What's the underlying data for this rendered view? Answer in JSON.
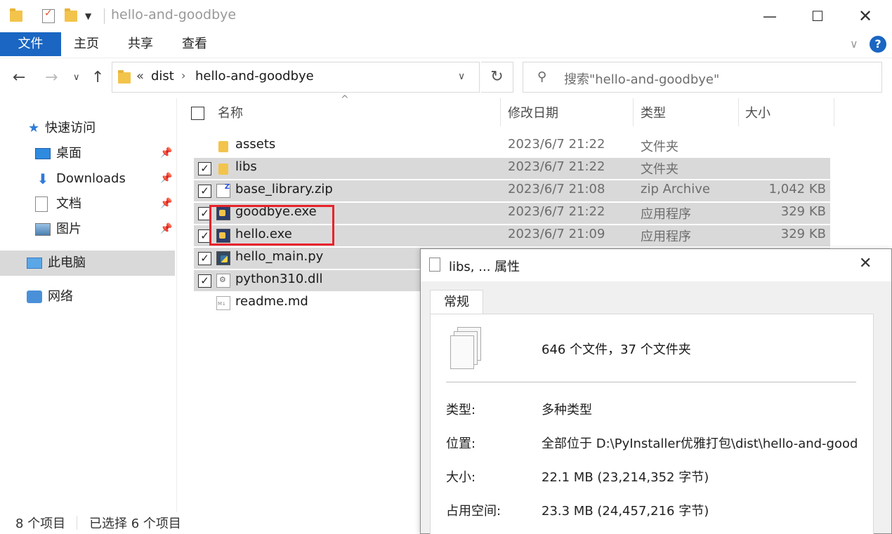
{
  "window": {
    "title": "hello-and-goodbye"
  },
  "ribbon": {
    "tabs": [
      "文件",
      "主页",
      "共享",
      "查看"
    ]
  },
  "address": {
    "prefix": "«",
    "crumbs": [
      "dist",
      "hello-and-goodbye"
    ]
  },
  "search": {
    "placeholder": "搜索\"hello-and-goodbye\""
  },
  "sidebar": {
    "quick_access": "快速访问",
    "items": [
      {
        "label": "桌面",
        "icon": "desktop-icon"
      },
      {
        "label": "Downloads",
        "icon": "download-icon"
      },
      {
        "label": "文档",
        "icon": "document-icon"
      },
      {
        "label": "图片",
        "icon": "pictures-icon"
      }
    ],
    "this_pc": "此电脑",
    "network": "网络"
  },
  "columns": {
    "name": "名称",
    "date": "修改日期",
    "type": "类型",
    "size": "大小"
  },
  "files": [
    {
      "name": "assets",
      "date": "2023/6/7 21:22",
      "type": "文件夹",
      "size": "",
      "icon": "folder",
      "selected": false
    },
    {
      "name": "libs",
      "date": "2023/6/7 21:22",
      "type": "文件夹",
      "size": "",
      "icon": "folder",
      "selected": true
    },
    {
      "name": "base_library.zip",
      "date": "2023/6/7 21:08",
      "type": "zip Archive",
      "size": "1,042 KB",
      "icon": "zip",
      "selected": true
    },
    {
      "name": "goodbye.exe",
      "date": "2023/6/7 21:22",
      "type": "应用程序",
      "size": "329 KB",
      "icon": "exe",
      "selected": true
    },
    {
      "name": "hello.exe",
      "date": "2023/6/7 21:09",
      "type": "应用程序",
      "size": "329 KB",
      "icon": "exe",
      "selected": true
    },
    {
      "name": "hello_main.py",
      "date": "",
      "type": "",
      "size": "",
      "icon": "py",
      "selected": true
    },
    {
      "name": "python310.dll",
      "date": "",
      "type": "",
      "size": "",
      "icon": "dll",
      "selected": true
    },
    {
      "name": "readme.md",
      "date": "",
      "type": "",
      "size": "",
      "icon": "md",
      "selected": false
    }
  ],
  "status": {
    "count": "8 个项目",
    "selected": "已选择 6 个项目"
  },
  "dialog": {
    "title": "libs, ... 属性",
    "tab": "常规",
    "summary": "646 个文件，37 个文件夹",
    "props": [
      {
        "label": "类型:",
        "value": "多种类型"
      },
      {
        "label": "位置:",
        "value": "全部位于 D:\\PyInstaller优雅打包\\dist\\hello-and-goodbye"
      },
      {
        "label": "大小:",
        "value": "22.1 MB (23,214,352 字节)"
      },
      {
        "label": "占用空间:",
        "value": "23.3 MB (24,457,216 字节)"
      }
    ]
  },
  "colors": {
    "accent": "#1a66c2",
    "selection": "#d9d9d9",
    "highlight_box": "#e8232b"
  }
}
